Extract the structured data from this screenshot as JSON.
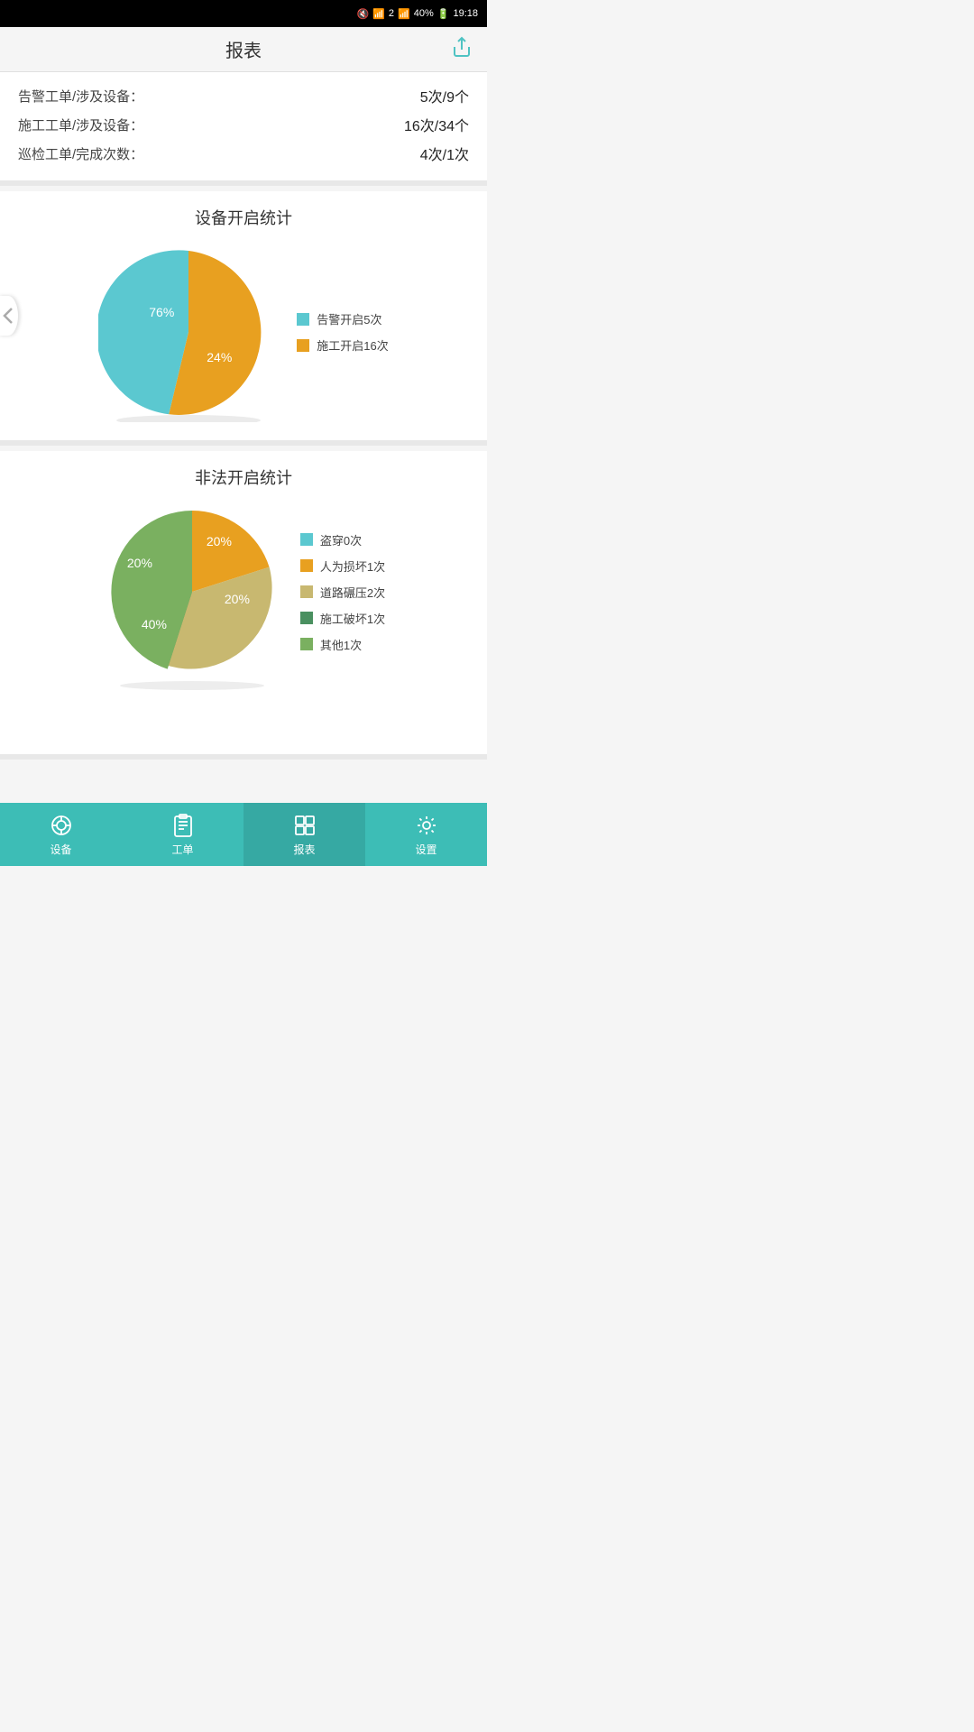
{
  "statusBar": {
    "time": "19:18",
    "battery": "40%"
  },
  "header": {
    "title": "报表",
    "shareLabel": "share"
  },
  "summary": {
    "rows": [
      {
        "label": "告警工单/涉及设备：",
        "value": "5次/9个"
      },
      {
        "label": "施工工单/涉及设备：",
        "value": "16次/34个"
      },
      {
        "label": "巡检工单/完成次数：",
        "value": "4次/1次"
      }
    ]
  },
  "chart1": {
    "title": "设备开启统计",
    "slices": [
      {
        "label": "告警开启5次",
        "percent": 24,
        "color": "#5bc8d0"
      },
      {
        "label": "施工开启16次",
        "percent": 76,
        "color": "#e8a020"
      }
    ],
    "pieLabels": [
      {
        "text": "76%",
        "x": "35%",
        "y": "38%"
      },
      {
        "text": "24%",
        "x": "62%",
        "y": "62%"
      }
    ]
  },
  "chart2": {
    "title": "非法开启统计",
    "slices": [
      {
        "label": "盗穿0次",
        "percent": 0,
        "color": "#5bc8d0"
      },
      {
        "label": "人为损坏1次",
        "percent": 20,
        "color": "#e8a020"
      },
      {
        "label": "道路碾压2次",
        "percent": 40,
        "color": "#c8b870"
      },
      {
        "label": "施工破坏1次",
        "percent": 20,
        "color": "#4a9060"
      },
      {
        "label": "其他1次",
        "percent": 20,
        "color": "#7ab060"
      }
    ],
    "pieLabels": [
      {
        "text": "20%",
        "x": "55%",
        "y": "22%"
      },
      {
        "text": "20%",
        "x": "68%",
        "y": "52%"
      },
      {
        "text": "40%",
        "x": "28%",
        "y": "68%"
      },
      {
        "text": "20%",
        "x": "20%",
        "y": "32%"
      }
    ]
  },
  "navBar": {
    "items": [
      {
        "id": "devices",
        "label": "设备",
        "active": false
      },
      {
        "id": "workorder",
        "label": "工单",
        "active": false
      },
      {
        "id": "reports",
        "label": "报表",
        "active": true
      },
      {
        "id": "settings",
        "label": "设置",
        "active": false
      }
    ]
  }
}
